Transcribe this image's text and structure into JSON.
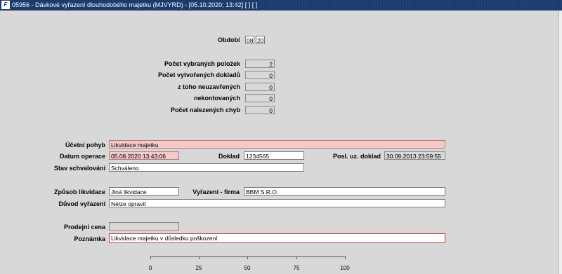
{
  "window": {
    "title": "05956 - Dávkové vyřazení dlouhodobého majetku (MJVYRD) - [05.10.2020; 13:42]  [ ]  [ ]",
    "logo": "F"
  },
  "period": {
    "label": "Období",
    "month": "08",
    "year": "20"
  },
  "stats": {
    "selected_label": "Počet vybraných položek",
    "selected_value": "2",
    "created_label": "Počet vytvořených dokladů",
    "created_value": "0",
    "unclosed_label": "z toho  neuzavřených",
    "unclosed_value": "0",
    "unposted_label": "nekontovaných",
    "unposted_value": "0",
    "errors_label": "Počet nalezených chyb",
    "errors_value": "0"
  },
  "form": {
    "ucetni_pohyb_label": "Účetní pohyb",
    "ucetni_pohyb_value": "Likvidace majetku",
    "datum_operace_label": "Datum operace",
    "datum_operace_value": "05.08.2020 13:43:06",
    "doklad_label": "Doklad",
    "doklad_value": "1234565",
    "posl_doklad_label": "Posl. uz. doklad",
    "posl_doklad_value": "30.09.2013 23:59:55",
    "stav_label": "Stav schvalování",
    "stav_value": "Schváleno",
    "zpusob_label": "Způsob likvidace",
    "zpusob_value": "Jiná likvidace",
    "firma_label": "Vyřazení - firma",
    "firma_value": "BBM S.R.O.",
    "duvod_label": "Důvod vyřazení",
    "duvod_value": "Nelze opravit",
    "cena_label": "Prodejní cena",
    "cena_value": "",
    "poznamka_label": "Poznámka",
    "poznamka_value": "Likvidace majetku v důsledku poškození"
  },
  "progress": {
    "ticks": [
      "0",
      "25",
      "50",
      "75",
      "100"
    ],
    "value_percent": 0
  }
}
